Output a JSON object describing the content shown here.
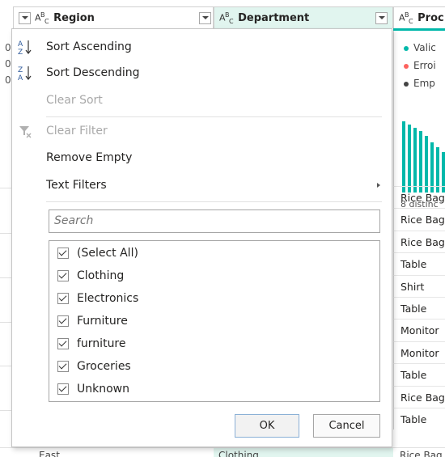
{
  "columns": {
    "region": {
      "type_icon": "ABC",
      "label": "Region"
    },
    "department": {
      "type_icon": "ABC",
      "label": "Department"
    },
    "product": {
      "type_icon": "ABC",
      "label": "Proc"
    }
  },
  "profile": {
    "valid_label": "Valic",
    "error_label": "Erroi",
    "empty_label": "Emp",
    "distinct_label": "8 distinc",
    "colors": {
      "valid": "#01b8aa",
      "error": "#fd625e",
      "empty": "#444444",
      "accent": "#01b8aa"
    }
  },
  "product_rows": [
    "Rice Bag",
    "Rice Bag",
    "Rice Bag",
    "Table",
    "Shirt",
    "Table",
    "Monitor",
    "Monitor",
    "Table",
    "Rice Bag",
    "Table"
  ],
  "left_fragments": [
    "0",
    "0",
    "0"
  ],
  "bottom_row": {
    "region": "East",
    "department": "Clothing",
    "product": "Rice Bag"
  },
  "menu": {
    "sort_ascending": "Sort Ascending",
    "sort_descending": "Sort Descending",
    "clear_sort": "Clear Sort",
    "clear_filter": "Clear Filter",
    "remove_empty": "Remove Empty",
    "text_filters": "Text Filters",
    "search_placeholder": "Search",
    "items": [
      {
        "label": "(Select All)",
        "checked": true
      },
      {
        "label": "Clothing",
        "checked": true
      },
      {
        "label": "Electronics",
        "checked": true
      },
      {
        "label": "Furniture",
        "checked": true
      },
      {
        "label": "furniture",
        "checked": true
      },
      {
        "label": "Groceries",
        "checked": true
      },
      {
        "label": "Unknown",
        "checked": true
      }
    ],
    "ok_label": "OK",
    "cancel_label": "Cancel"
  }
}
